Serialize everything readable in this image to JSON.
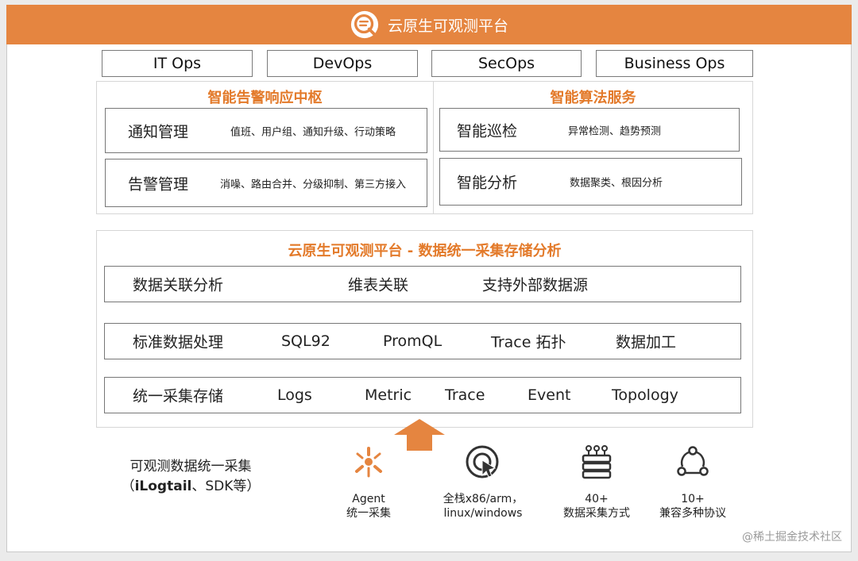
{
  "header": {
    "title": "云原生可观测平台"
  },
  "ops_tabs": [
    {
      "label": "IT Ops"
    },
    {
      "label": "DevOps"
    },
    {
      "label": "SecOps"
    },
    {
      "label": "Business Ops"
    }
  ],
  "alert_center": {
    "title": "智能告警响应中枢",
    "cards": [
      {
        "name": "通知管理",
        "desc": "值班、用户组、通知升级、行动策略"
      },
      {
        "name": "告警管理",
        "desc": "消噪、路由合并、分级抑制、第三方接入"
      }
    ]
  },
  "algo_service": {
    "title": "智能算法服务",
    "cards": [
      {
        "name": "智能巡检",
        "desc": "异常检测、趋势预测"
      },
      {
        "name": "智能分析",
        "desc": "数据聚类、根因分析"
      }
    ]
  },
  "data_platform": {
    "title": "云原生可观测平台 - 数据统一采集存储分析",
    "rows": [
      {
        "items": [
          "数据关联分析",
          "维表关联",
          "支持外部数据源"
        ]
      },
      {
        "items": [
          "标准数据处理",
          "SQL92",
          "PromQL",
          "Trace 拓扑",
          "数据加工"
        ]
      },
      {
        "items": [
          "统一采集存储",
          "Logs",
          "Metric",
          "Trace",
          "Event",
          "Topology"
        ]
      }
    ]
  },
  "collection": {
    "line1": "可观测数据统一采集",
    "paren_open": "（",
    "bold": "iLogtail",
    "rest": "、SDK等）"
  },
  "features": [
    {
      "icon": "agent-icon",
      "line1": "Agent",
      "line2": "统一采集"
    },
    {
      "icon": "cursor-target-icon",
      "line1": "全栈x86/arm，",
      "line2": "linux/windows"
    },
    {
      "icon": "database-icon",
      "line1": "40+",
      "line2": "数据采集方式"
    },
    {
      "icon": "protocol-network-icon",
      "line1": "10+",
      "line2": "兼容多种协议"
    }
  ],
  "watermark": "@稀土掘金技术社区",
  "colors": {
    "accent": "#e58540",
    "accent_text": "#e37a2a",
    "border": "#777777"
  }
}
